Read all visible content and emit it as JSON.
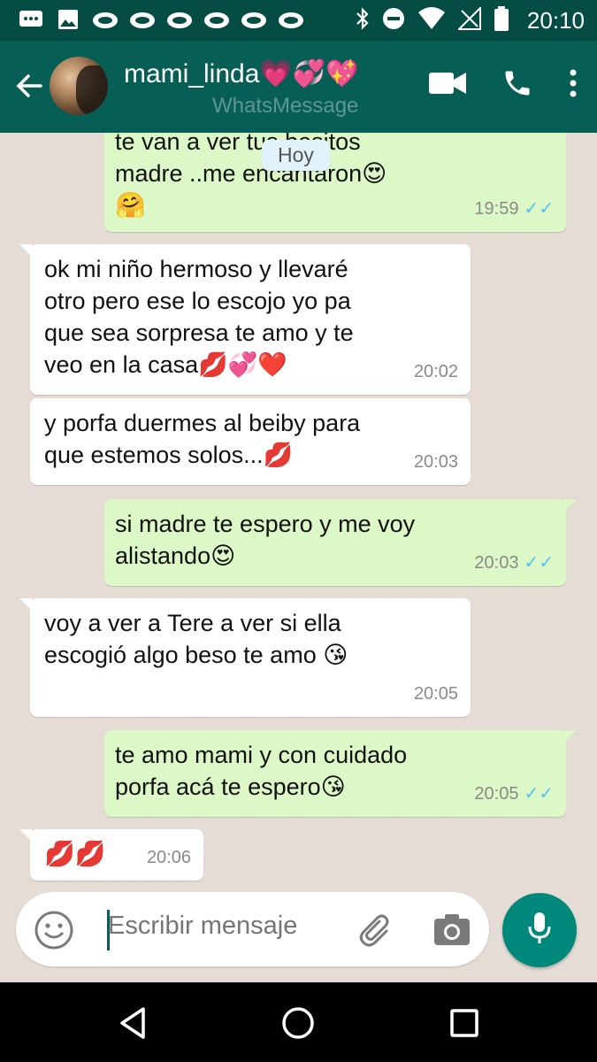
{
  "status_bar": {
    "time": "20:10",
    "icons": [
      "message-icon",
      "image-icon",
      "cloud-icon",
      "bluetooth-icon",
      "dnd-icon",
      "wifi-icon",
      "signal-icon",
      "battery-icon"
    ]
  },
  "header": {
    "contact_name": "mami_linda💗💞💖",
    "subtitle": "WhatsMessage",
    "actions": [
      "video-call-icon",
      "phone-icon",
      "more-icon"
    ]
  },
  "date_chip": "Hoy",
  "messages": [
    {
      "dir": "out",
      "text_line1": "te van a ver tus besitos",
      "text_line2": "madre ..me encantaron😍",
      "text_line3": "🤗",
      "time": "19:59",
      "ticks": "✓✓"
    },
    {
      "dir": "in",
      "text": "ok mi niño hermoso y llevaré otro pero ese lo escojo yo pa que sea sorpresa te amo y te veo en la casa💋💞❤️",
      "time": "20:02"
    },
    {
      "dir": "in",
      "text": "y porfa duermes al beiby para que estemos solos...💋",
      "time": "20:03"
    },
    {
      "dir": "out",
      "text": "si madre te espero y me voy alistando😍",
      "time": "20:03",
      "ticks": "✓✓"
    },
    {
      "dir": "in",
      "text": "voy a ver a Tere a ver si ella escogió algo beso te amo 😘",
      "time": "20:05"
    },
    {
      "dir": "out",
      "text": "te amo mami y con cuidado porfa acá te espero😘",
      "time": "20:05",
      "ticks": "✓✓"
    },
    {
      "dir": "in",
      "text": "💋💋",
      "time": "20:06"
    }
  ],
  "composer": {
    "placeholder": "Escribir mensaje"
  },
  "colors": {
    "status_bar": "#054d44",
    "app_bar": "#075e54",
    "incoming": "#ffffff",
    "outgoing": "#dcf8c6",
    "mic_button": "#00897b",
    "read_ticks": "#4fc3f7"
  }
}
